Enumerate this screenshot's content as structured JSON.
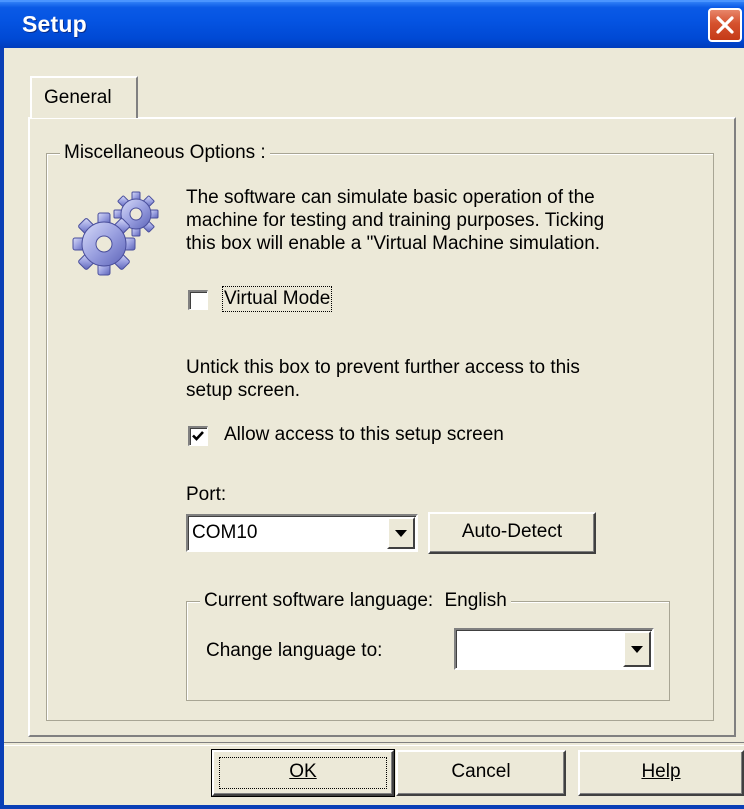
{
  "window": {
    "title": "Setup"
  },
  "tabs": [
    {
      "label": "General",
      "selected": true
    }
  ],
  "misc_group": {
    "legend": "Miscellaneous Options :",
    "icon": "gears-icon",
    "virtual_description_lines": [
      "The software can simulate basic operation of the",
      "machine for testing and training purposes. Ticking",
      "this box will enable a \"Virtual Machine simulation."
    ],
    "virtual_mode": {
      "label": "Virtual Mode",
      "checked": false
    },
    "access_description_lines": [
      "Untick this box to prevent further access to this",
      "setup screen."
    ],
    "allow_access": {
      "label": "Allow access to this setup screen",
      "checked": true
    },
    "port": {
      "label": "Port:",
      "selected": "COM10",
      "auto_detect_label": "Auto-Detect"
    },
    "language_group": {
      "legend_prefix": "Current software language:",
      "current_language": "English",
      "change_label": "Change language to:",
      "change_selected": ""
    }
  },
  "footer": {
    "ok_label": "OK",
    "cancel_label": "Cancel",
    "help_label": "Help"
  },
  "colors": {
    "titlebar": "#0054e3",
    "face": "#ece9d8",
    "close": "#c53a17"
  }
}
